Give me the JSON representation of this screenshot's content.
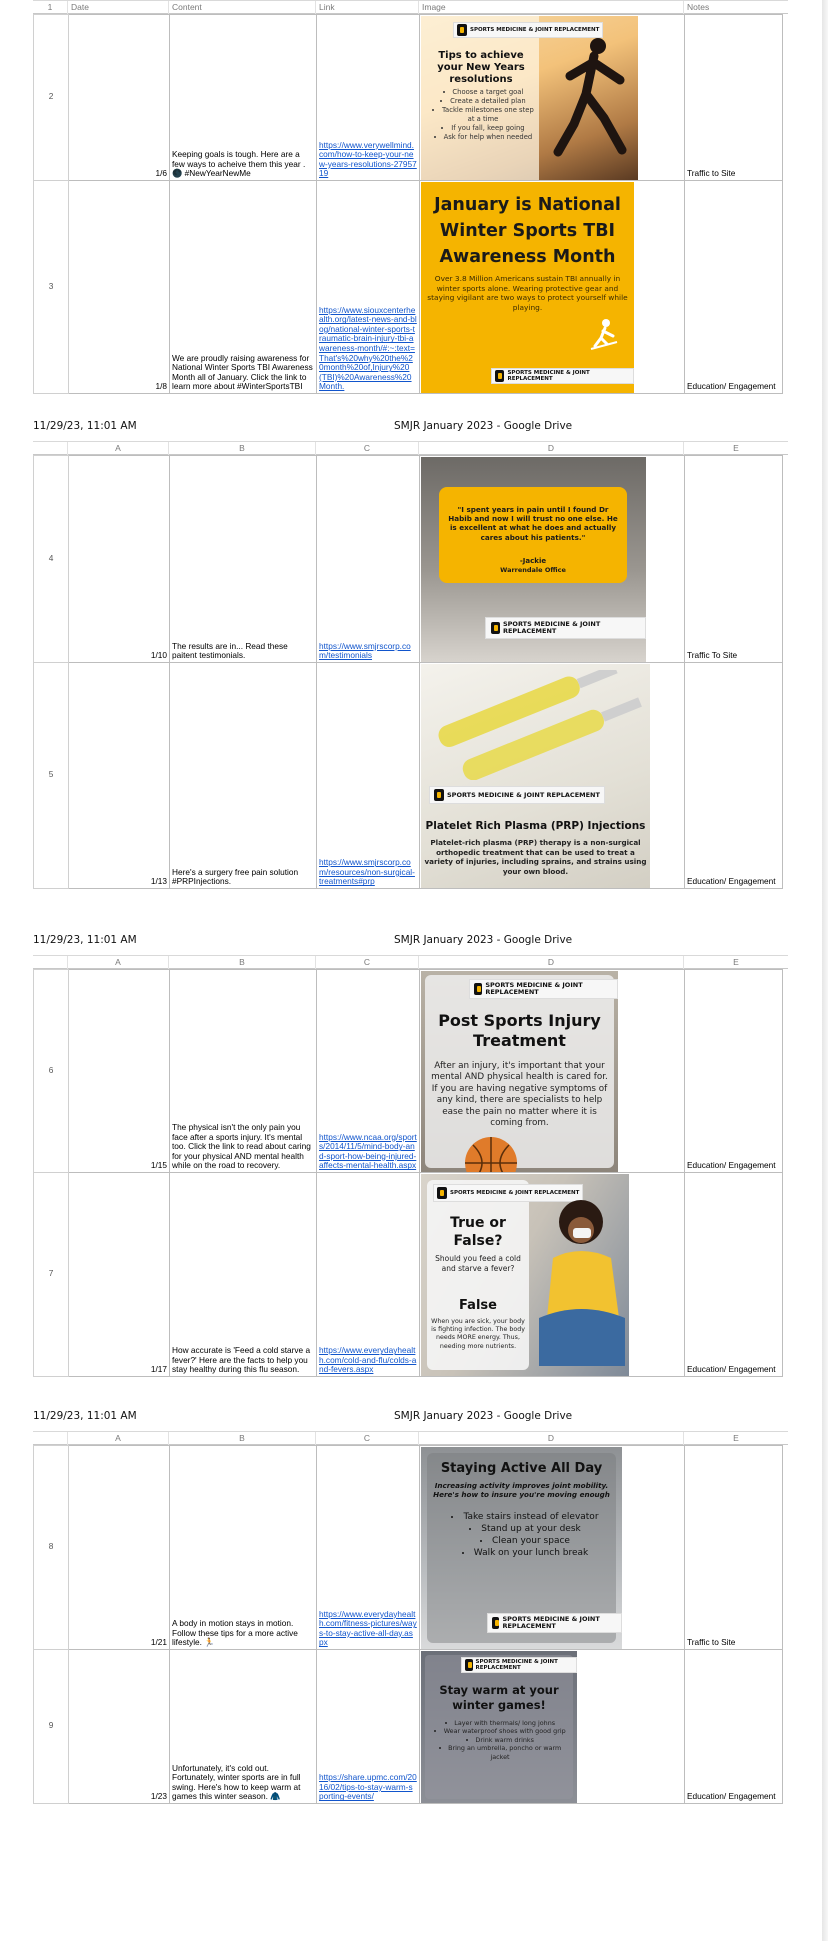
{
  "print_header": {
    "timestamp": "11/29/23, 11:01 AM",
    "doc_title": "SMJR January 2023 - Google Drive"
  },
  "columns": {
    "a": "A",
    "b": "B",
    "c": "C",
    "d": "D",
    "e": "E"
  },
  "header_row": {
    "num": "1",
    "date": "Date",
    "content": "Content",
    "link": "Link",
    "image": "Image",
    "notes": "Notes"
  },
  "logo_text": "SPORTS MEDICINE & JOINT REPLACEMENT",
  "rows": [
    {
      "num": "2",
      "date": "1/6",
      "content": "Keeping goals is tough. Here are a few ways to acheive them this year . 🌑 #NewYearNewMe",
      "link": "https://www.verywellmind.com/how-to-keep-your-new-years-resolutions-2795719",
      "notes": "Traffic to Site",
      "image": {
        "title": "Tips to achieve your New Years resolutions",
        "bullets": [
          "Choose a target goal",
          "Create a detailed plan",
          "Tackle milestones one step at a time",
          "If you fall, keep going",
          "Ask for help when needed"
        ]
      }
    },
    {
      "num": "3",
      "date": "1/8",
      "content": "We are proudly raising awareness for National Winter Sports TBI Awareness Month all of January. Click the link to learn more about #WinterSportsTBI",
      "link": "https://www.siouxcenterhealth.org/latest-news-and-blog/national-winter-sports-traumatic-brain-injury-tbi-awareness-month/#:~:text=That's%20why%20the%20month%20of,Injury%20(TBI)%20Awareness%20Month.",
      "notes": "Education/ Engagement",
      "image": {
        "title": "January is National Winter Sports TBI Awareness Month",
        "body": "Over 3.8 Million Americans sustain TBI annually in winter sports alone. Wearing protective gear and staying vigilant are two ways to protect yourself while playing."
      }
    },
    {
      "num": "4",
      "date": "1/10",
      "content": "The results are in... Read these paitent testimonials.",
      "link": "https://www.smjrscorp.com/testimonials",
      "notes": "Traffic To Site",
      "image": {
        "quote": "\"I spent years in pain until I found Dr Habib and now I will trust no one else. He is excellent at what he does and actually cares about his patients.\"",
        "author": "-Jackie",
        "office": "Warrendale Office"
      }
    },
    {
      "num": "5",
      "date": "1/13",
      "content": "Here's a surgery free pain solution #PRPInjections.",
      "link": "https://www.smjrscorp.com/resources/non-surgical-treatments#prp",
      "notes": "Education/ Engagement",
      "image": {
        "title": "Platelet Rich Plasma (PRP) Injections",
        "body": "Platelet-rich plasma (PRP) therapy is a non-surgical orthopedic treatment that can be used to treat a variety of injuries, including sprains, and strains using your own blood."
      }
    },
    {
      "num": "6",
      "date": "1/15",
      "content": "The physical isn't the only pain you face after a sports injury. It's mental too. Click the link to read about caring for your physical AND mental health while on the road to recovery.",
      "link": "https://www.ncaa.org/sports/2014/11/5/mind-body-and-sport-how-being-injured-affects-mental-health.aspx",
      "notes": "Education/ Engagement",
      "image": {
        "title": "Post Sports Injury Treatment",
        "body": "After an injury, it's important that your mental AND physical health is cared for. If you are having negative symptoms of any kind, there are specialists to help ease the pain no matter where it is coming from."
      }
    },
    {
      "num": "7",
      "date": "1/17",
      "content": "How accurate is 'Feed a cold starve a fever?' Here are the facts to help you stay healthy during this flu season.",
      "link": "https://www.everydayhealth.com/cold-and-flu/colds-and-fevers.aspx",
      "notes": "Education/ Engagement",
      "image": {
        "title": "True or False?",
        "question": "Should you feed a cold and starve a fever?",
        "answer": "False",
        "body": "When you are sick, your body is fighting infection. The body needs MORE energy. Thus, needing more nutrients."
      }
    },
    {
      "num": "8",
      "date": "1/21",
      "content": "A body in motion stays in motion. Follow these tips for a more active lifestyle. 🏃",
      "link": "https://www.everydayhealth.com/fitness-pictures/ways-to-stay-active-all-day.aspx",
      "notes": "Traffic to Site",
      "image": {
        "title": "Staying Active All Day",
        "subtitle": "Increasing activity improves joint mobility. Here's how to insure you're moving enough",
        "bullets": [
          "Take stairs instead of elevator",
          "Stand up at your desk",
          "Clean your space",
          "Walk on your lunch break"
        ]
      }
    },
    {
      "num": "9",
      "date": "1/23",
      "content": "Unfortunately, it's cold out. Fortunately, winter sports are in full swing. Here's how to keep warm at games this winter season. 🧥",
      "link": "https://share.upmc.com/2016/02/tips-to-stay-warm-sporting-events/",
      "notes": "Education/ Engagement",
      "image": {
        "title": "Stay warm at your winter games!",
        "bullets": [
          "Layer with thermals/ long johns",
          "Wear waterproof shoes with good grip",
          "Drink warm drinks",
          "Bring an umbrella, poncho or warm jacket"
        ]
      }
    }
  ],
  "colors": {
    "accent": "#f5b400",
    "link": "#1155cc",
    "grid": "#bdbdbd"
  }
}
